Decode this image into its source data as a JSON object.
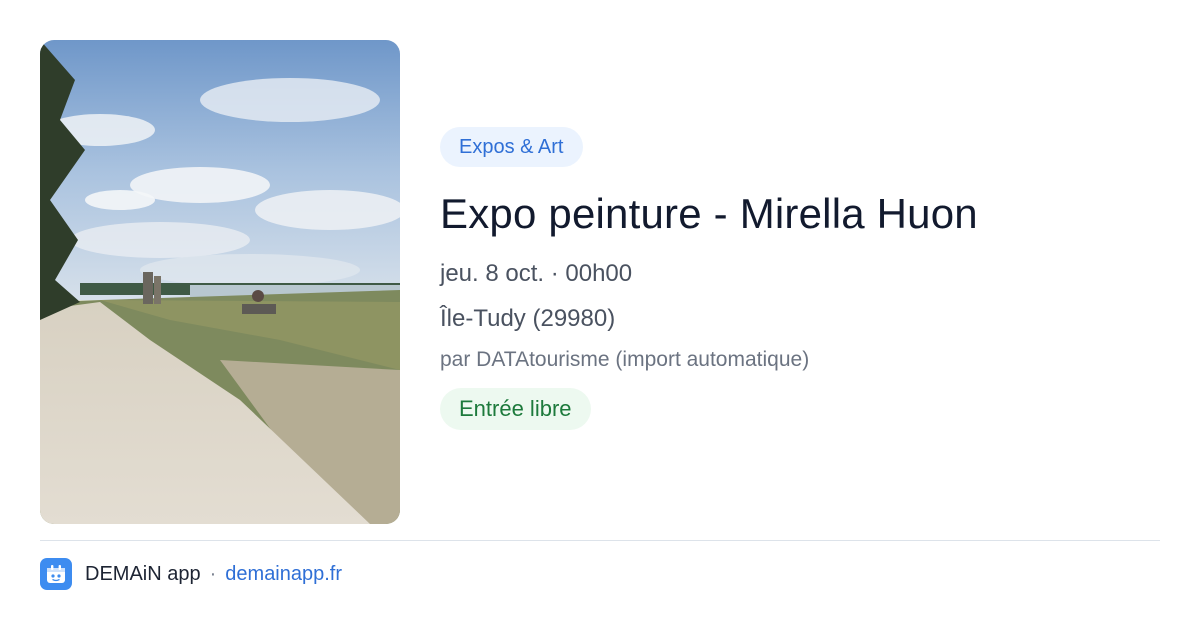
{
  "event": {
    "category": "Expos & Art",
    "title": "Expo peinture - Mirella Huon",
    "date_time": "jeu. 8 oct. · 00h00",
    "location": "Île-Tudy (29980)",
    "organizer": "par DATAtourisme (import automatique)",
    "price": "Entrée libre"
  },
  "footer": {
    "app_name": "DEMAiN app",
    "separator": "·",
    "link_text": "demainapp.fr"
  },
  "icons": {
    "photo": "beach-path-photo",
    "logo": "demain-app-logo-icon"
  },
  "colors": {
    "category_badge_bg": "#ebf3fe",
    "category_badge_text": "#2f6fd6",
    "price_badge_bg": "#edf9f0",
    "price_badge_text": "#1d7a3c",
    "link": "#2f6fd6",
    "logo": "#3d8cf0"
  }
}
